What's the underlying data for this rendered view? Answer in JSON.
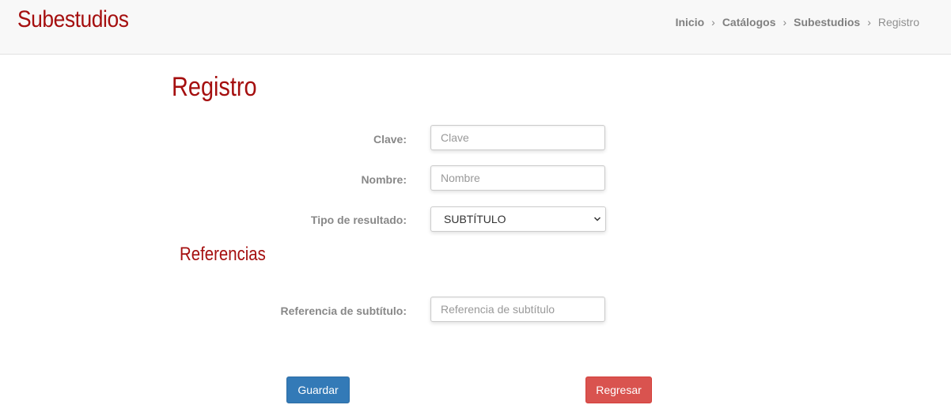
{
  "header": {
    "title": "Subestudios",
    "breadcrumb": [
      "Inicio",
      "Catálogos",
      "Subestudios",
      "Registro"
    ]
  },
  "page": {
    "heading": "Registro"
  },
  "form": {
    "clave": {
      "label": "Clave:",
      "placeholder": "Clave",
      "value": ""
    },
    "nombre": {
      "label": "Nombre:",
      "placeholder": "Nombre",
      "value": ""
    },
    "tipo_resultado": {
      "label": "Tipo de resultado:",
      "selected": "SUBTÍTULO"
    }
  },
  "referencias": {
    "heading": "Referencias",
    "subtitulo": {
      "label": "Referencia de subtítulo:",
      "placeholder": "Referencia de subtítulo",
      "value": ""
    }
  },
  "actions": {
    "save_label": "Guardar",
    "back_label": "Regresar"
  },
  "colors": {
    "brand": "#a50f0f",
    "primary": "#337ab7",
    "danger": "#d9534f"
  }
}
